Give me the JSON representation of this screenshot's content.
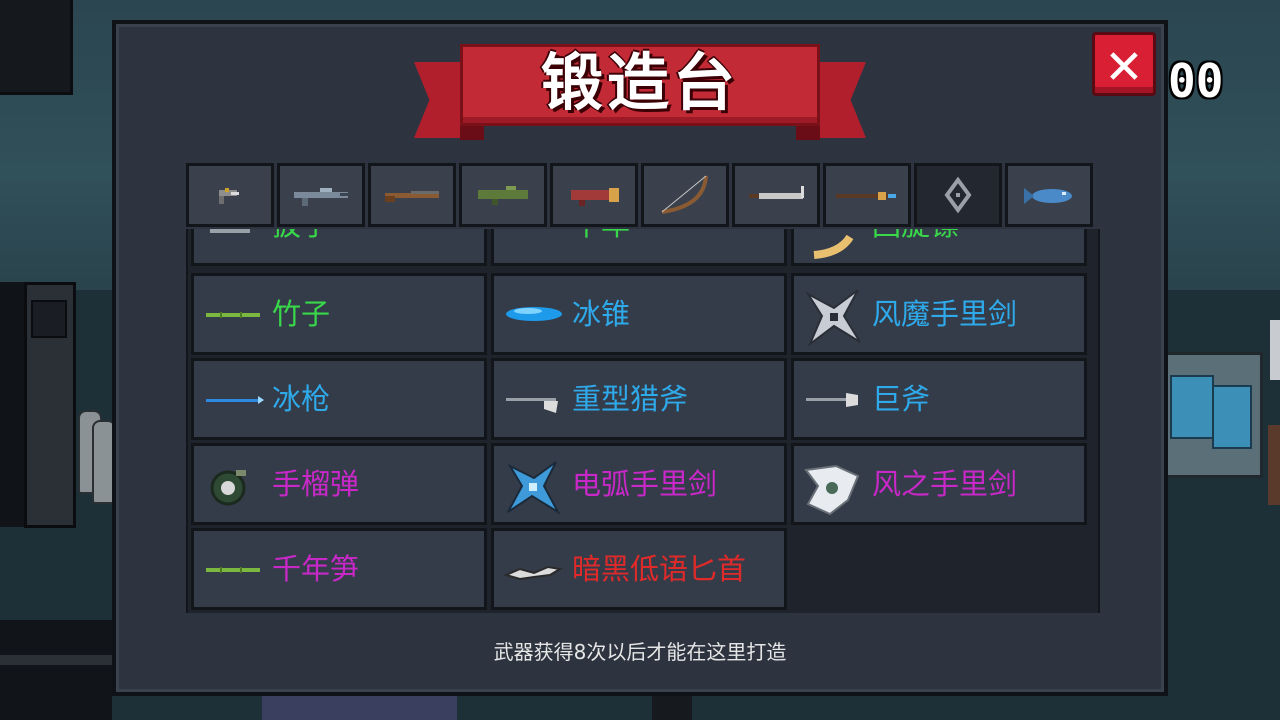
{
  "title": "锻造台",
  "counter": "00",
  "close_label": "✕",
  "tabs": [
    "pistol-icon",
    "rifle-icon",
    "shotgun-icon",
    "launcher-icon",
    "bazooka-icon",
    "bow-icon",
    "blade-icon",
    "staff-icon",
    "shuriken-icon",
    "fish-icon"
  ],
  "partial_row": [
    {
      "name": "扳子",
      "color": "green"
    },
    {
      "name": "千年",
      "color": "green"
    },
    {
      "name": "回旋镖",
      "color": "green"
    }
  ],
  "weapons": [
    {
      "name": "竹子",
      "color": "green",
      "icon": "bamboo-icon"
    },
    {
      "name": "冰锥",
      "color": "blue",
      "icon": "icicle-icon"
    },
    {
      "name": "风魔手里剑",
      "color": "blue",
      "icon": "fuma-shuriken-icon"
    },
    {
      "name": "冰枪",
      "color": "blue",
      "icon": "ice-spear-icon"
    },
    {
      "name": "重型猎斧",
      "color": "blue",
      "icon": "heavy-axe-icon"
    },
    {
      "name": "巨斧",
      "color": "blue",
      "icon": "giant-axe-icon"
    },
    {
      "name": "手榴弹",
      "color": "purple",
      "icon": "grenade-icon"
    },
    {
      "name": "电弧手里剑",
      "color": "purple",
      "icon": "arc-shuriken-icon"
    },
    {
      "name": "风之手里剑",
      "color": "purple",
      "icon": "wind-shuriken-icon"
    },
    {
      "name": "千年笋",
      "color": "purple",
      "icon": "bamboo-shoot-icon"
    },
    {
      "name": "暗黑低语匕首",
      "color": "red",
      "icon": "dark-dagger-icon"
    }
  ],
  "footer": "武器获得8次以后才能在这里打造",
  "colors": {
    "green": "#38d84a",
    "blue": "#2ea9ea",
    "purple": "#c828c8",
    "red": "#e02a2a",
    "banner": "#c22a36",
    "close": "#d81f34"
  }
}
